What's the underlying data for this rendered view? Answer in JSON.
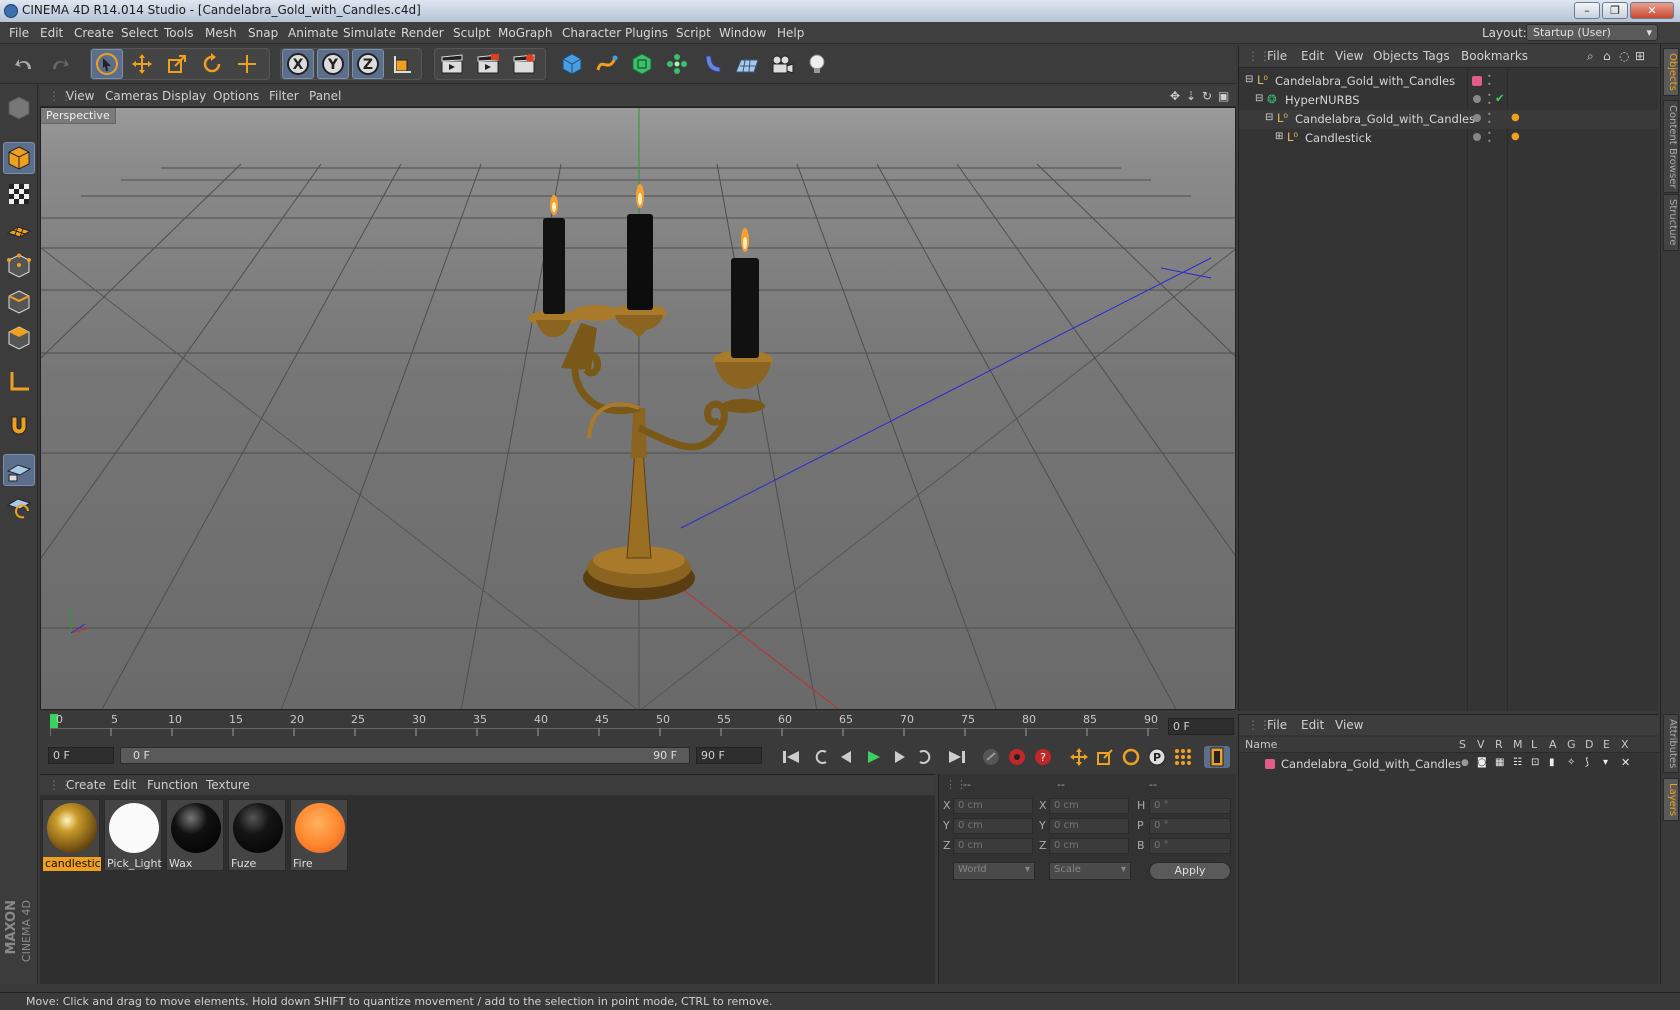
{
  "window": {
    "title": "CINEMA 4D R14.014 Studio - [Candelabra_Gold_with_Candles.c4d]",
    "minimize": "–",
    "maximize": "❐",
    "close": "✕"
  },
  "menubar": {
    "items": [
      "File",
      "Edit",
      "Create",
      "Select",
      "Tools",
      "Mesh",
      "Snap",
      "Animate",
      "Simulate",
      "Render",
      "Sculpt",
      "MoGraph",
      "Character",
      "Plugins",
      "Script",
      "Window",
      "Help"
    ],
    "layout_label": "Layout:",
    "layout_value": "Startup (User)"
  },
  "viewport": {
    "menu": [
      "View",
      "Cameras",
      "Display",
      "Options",
      "Filter",
      "Panel"
    ],
    "camera_label": "Perspective"
  },
  "timeline": {
    "ticks": [
      "0",
      "5",
      "10",
      "15",
      "20",
      "25",
      "30",
      "35",
      "40",
      "45",
      "50",
      "55",
      "60",
      "65",
      "70",
      "75",
      "80",
      "85",
      "90"
    ],
    "current_frame": "0 F",
    "start_field": "0 F",
    "range_start": "0 F",
    "range_end": "90 F",
    "end_field": "90 F"
  },
  "materials": {
    "menu": [
      "Create",
      "Edit",
      "Function",
      "Texture"
    ],
    "items": [
      {
        "name": "candlestick",
        "selected": true
      },
      {
        "name": "Pick_Light",
        "selected": false
      },
      {
        "name": "Wax",
        "selected": false
      },
      {
        "name": "Fuze",
        "selected": false
      },
      {
        "name": "Fire",
        "selected": false
      }
    ]
  },
  "coordinates": {
    "headers": [
      "--",
      "--",
      "--"
    ],
    "rows": [
      {
        "a_label": "X",
        "a_val": "0 cm",
        "b_label": "X",
        "b_val": "0 cm",
        "c_label": "H",
        "c_val": "0 °"
      },
      {
        "a_label": "Y",
        "a_val": "0 cm",
        "b_label": "Y",
        "b_val": "0 cm",
        "c_label": "P",
        "c_val": "0 °"
      },
      {
        "a_label": "Z",
        "a_val": "0 cm",
        "b_label": "Z",
        "b_val": "0 cm",
        "c_label": "B",
        "c_val": "0 °"
      }
    ],
    "world": "World",
    "scale": "Scale",
    "apply": "Apply"
  },
  "object_manager": {
    "menu": [
      "File",
      "Edit",
      "View",
      "Objects",
      "Tags",
      "Bookmarks"
    ],
    "objects": [
      {
        "name": "Candelabra_Gold_with_Candles"
      },
      {
        "name": "HyperNURBS"
      },
      {
        "name": "Candelabra_Gold_with_Candles"
      },
      {
        "name": "Candlestick"
      }
    ]
  },
  "layer_manager": {
    "menu": [
      "File",
      "Edit",
      "View"
    ],
    "name_header": "Name",
    "columns": [
      "S",
      "V",
      "R",
      "M",
      "L",
      "A",
      "G",
      "D",
      "E",
      "X"
    ],
    "layers": [
      {
        "name": "Candelabra_Gold_with_Candles",
        "color": "#e05c8a"
      }
    ]
  },
  "side_tabs": [
    "Objects",
    "Content Browser",
    "Structure",
    "Attributes",
    "Layers"
  ],
  "status": "Move: Click and drag to move elements. Hold down SHIFT to quantize movement / add to the selection in point mode, CTRL to remove.",
  "brand": {
    "line1": "MAXON",
    "line2": "CINEMA 4D"
  },
  "colors": {
    "accent": "#f0a020",
    "selection_blue": "#5b6f8c",
    "layer_pink": "#e05c8a"
  }
}
